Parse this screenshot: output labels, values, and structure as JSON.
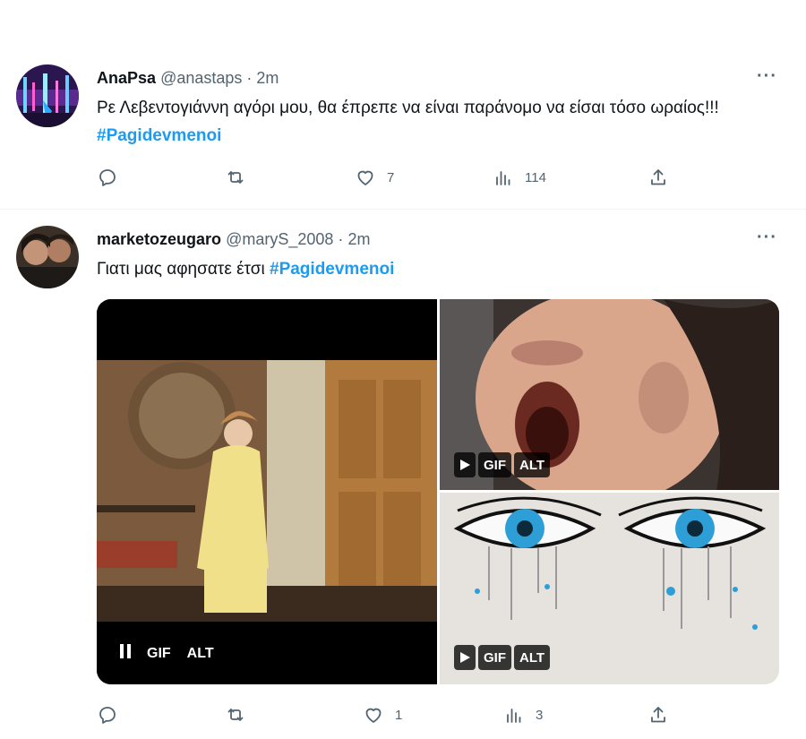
{
  "tweets": [
    {
      "display_name": "AnaPsa",
      "handle": "@anastaps",
      "separator": "·",
      "time": "2m",
      "more_label": "···",
      "text": "Ρε Λεβεντογιάννη αγόρι μου, θα έπρεπε να είναι παράνομο να είσαι τόσο ωραίος!!! ",
      "hashtag": "#Pagidevmenoi",
      "likes": "7",
      "views": "114"
    },
    {
      "display_name": "marketozeugaro",
      "handle": "@maryS_2008",
      "separator": "·",
      "time": "2m",
      "more_label": "···",
      "text": "Γιατι μας αφησατε έτσι ",
      "hashtag": "#Pagidevmenoi",
      "likes": "1",
      "views": "3",
      "media": {
        "left": {
          "gif_label": "GIF",
          "alt_label": "ALT",
          "state": "playing"
        },
        "top_right": {
          "gif_label": "GIF",
          "alt_label": "ALT",
          "state": "paused"
        },
        "bottom_right": {
          "gif_label": "GIF",
          "alt_label": "ALT",
          "state": "paused"
        }
      }
    }
  ],
  "icons": {
    "reply": "reply-icon",
    "retweet": "retweet-icon",
    "like": "heart-icon",
    "views": "views-icon",
    "share": "share-icon"
  },
  "colors": {
    "accent": "#1d9bf0",
    "muted": "#536471",
    "text": "#0f1419"
  }
}
